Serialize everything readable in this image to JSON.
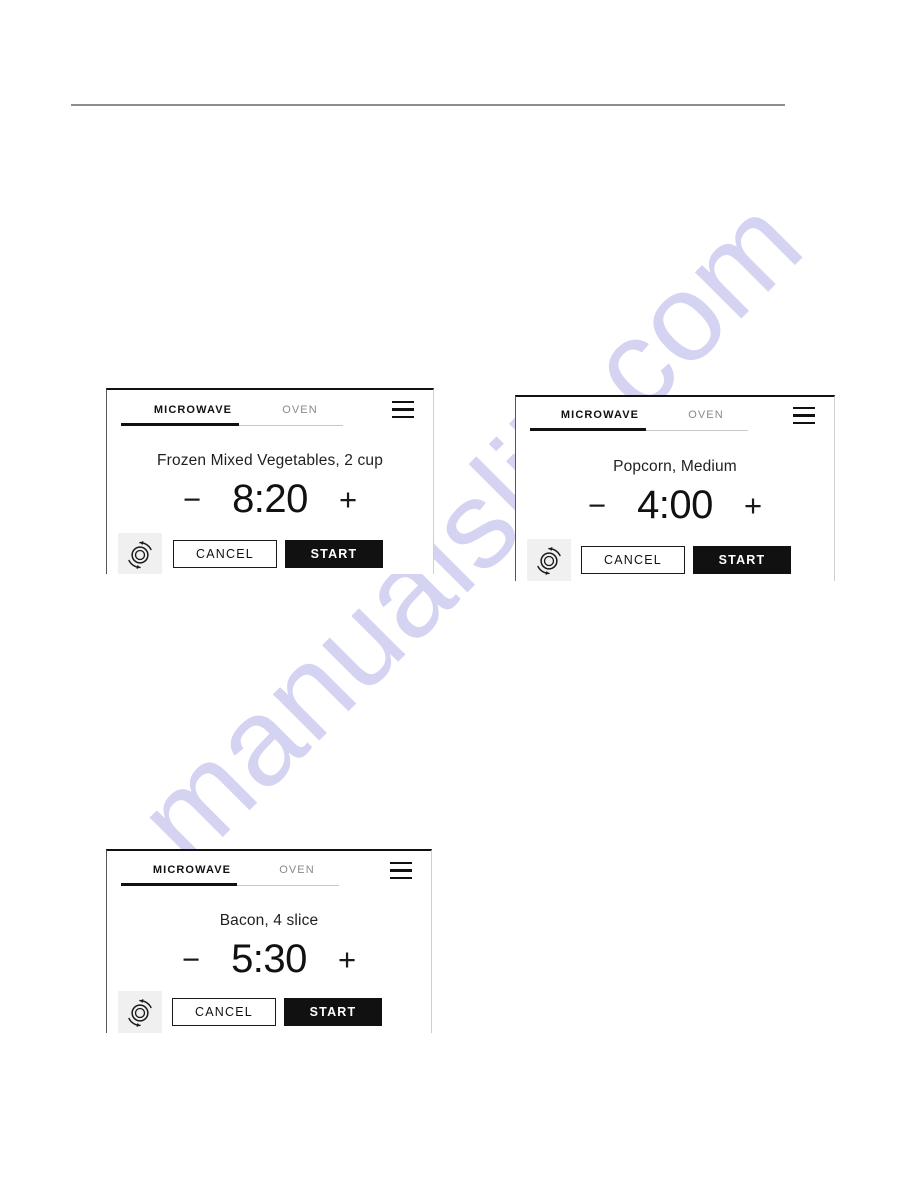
{
  "page": {
    "background_color": "#ffffff",
    "header_rule_color": "#8d8d8d"
  },
  "watermark": {
    "text": "manualslib.com",
    "color": "#cdcaf0"
  },
  "panels": [
    {
      "id": "panel-frozen-vegetables",
      "tabs": [
        {
          "label": "MICROWAVE",
          "active": true
        },
        {
          "label": "OVEN",
          "active": false
        }
      ],
      "menu_icon": "hamburger-menu-icon",
      "sensor_icon": "sensor-cook-icon",
      "food_label": "Frozen Mixed Vegetables, 2 cup",
      "timer": {
        "decrement_label": "−",
        "value": "8:20",
        "increment_label": "+"
      },
      "cancel_label": "CANCEL",
      "start_label": "START"
    },
    {
      "id": "panel-popcorn",
      "tabs": [
        {
          "label": "MICROWAVE",
          "active": true
        },
        {
          "label": "OVEN",
          "active": false
        }
      ],
      "menu_icon": "hamburger-menu-icon",
      "sensor_icon": "sensor-cook-icon",
      "food_label": "Popcorn, Medium",
      "timer": {
        "decrement_label": "−",
        "value": "4:00",
        "increment_label": "+"
      },
      "cancel_label": "CANCEL",
      "start_label": "START"
    },
    {
      "id": "panel-bacon",
      "tabs": [
        {
          "label": "MICROWAVE",
          "active": true
        },
        {
          "label": "OVEN",
          "active": false
        }
      ],
      "menu_icon": "hamburger-menu-icon",
      "sensor_icon": "sensor-cook-icon",
      "food_label": "Bacon, 4 slice",
      "timer": {
        "decrement_label": "−",
        "value": "5:30",
        "increment_label": "+"
      },
      "cancel_label": "CANCEL",
      "start_label": "START"
    }
  ]
}
